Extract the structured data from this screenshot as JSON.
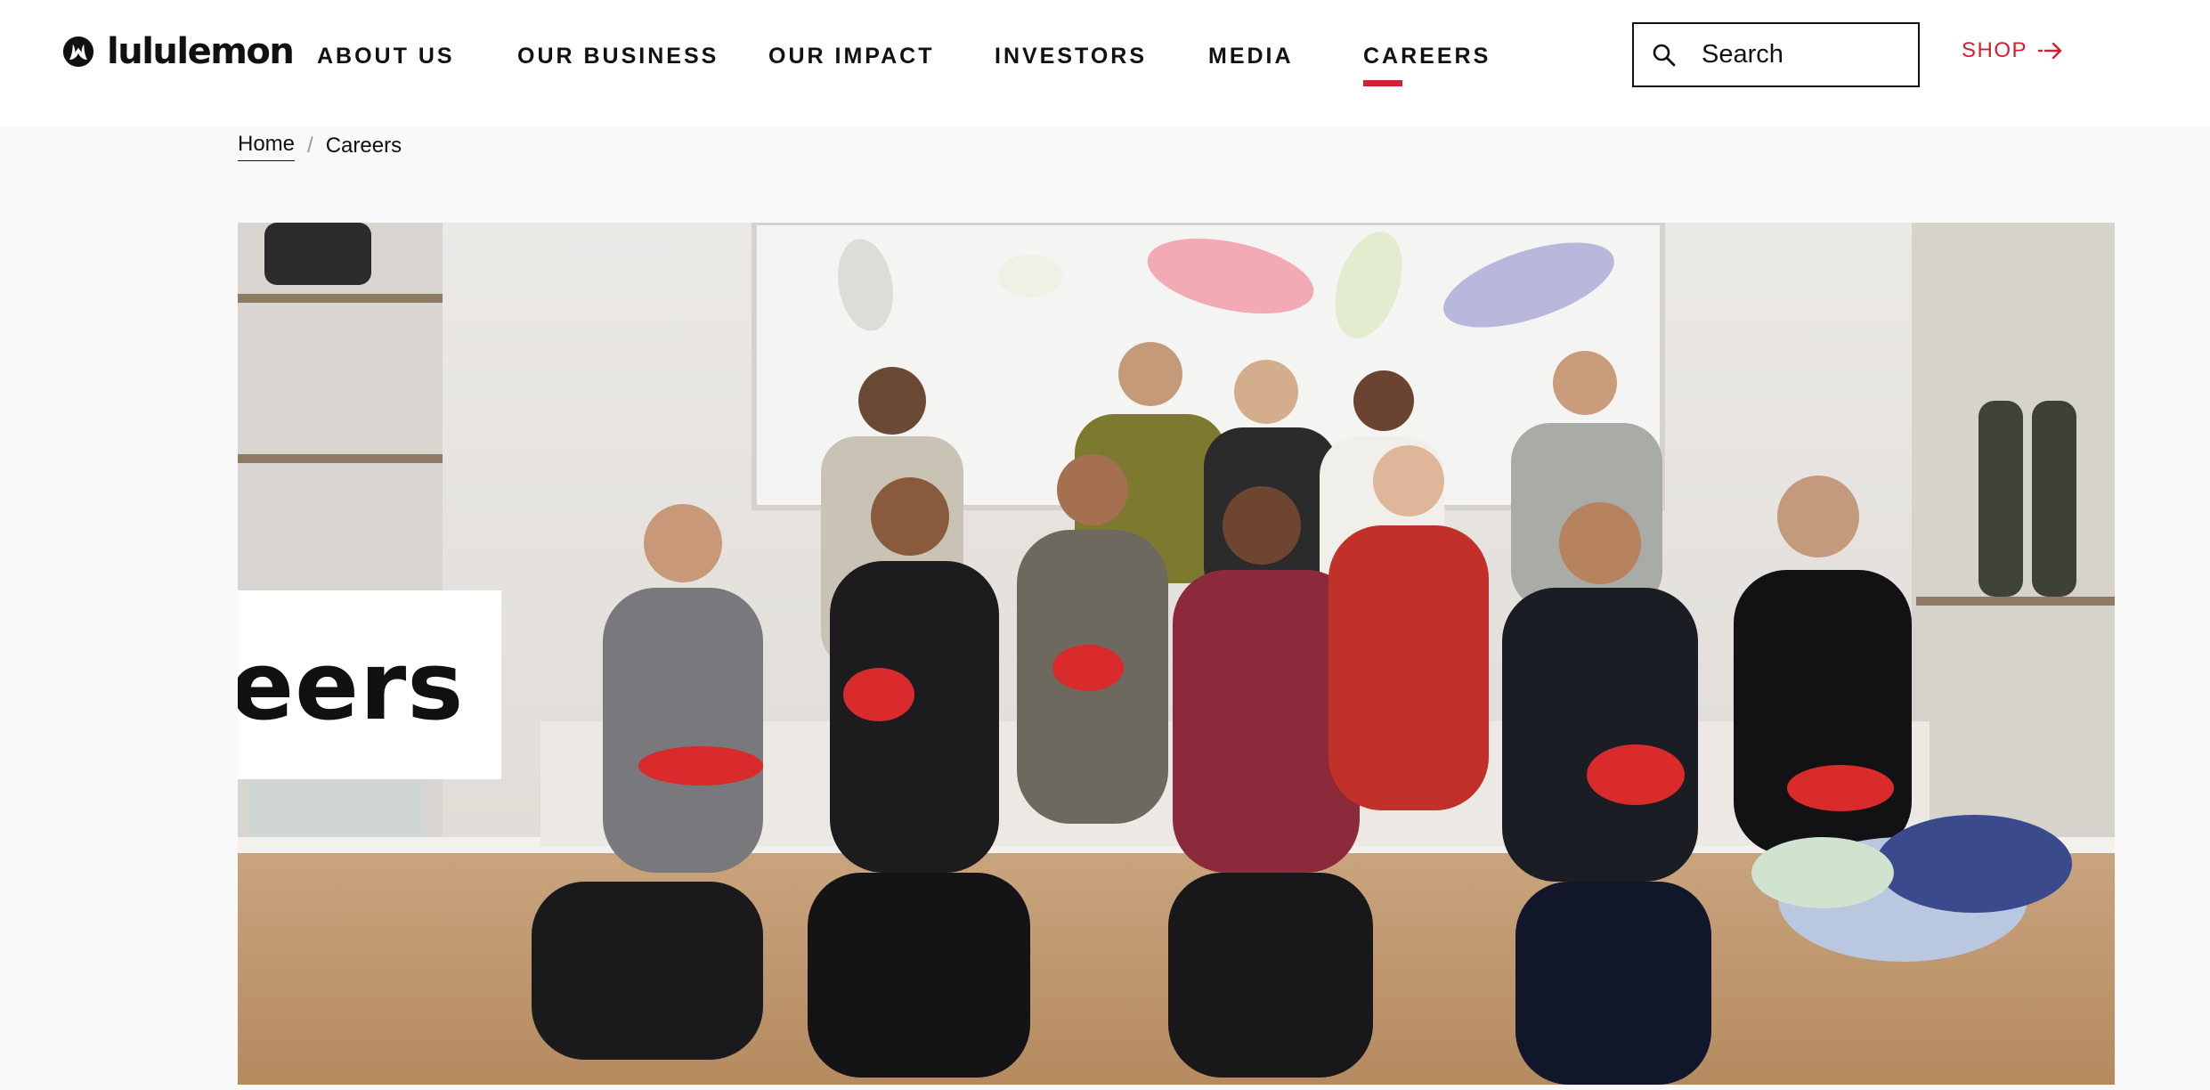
{
  "brand": {
    "name": "lululemon",
    "accent_color": "#d22030"
  },
  "nav": {
    "items": [
      {
        "label": "ABOUT US",
        "active": false
      },
      {
        "label": "OUR BUSINESS",
        "active": false
      },
      {
        "label": "OUR IMPACT",
        "active": false
      },
      {
        "label": "INVESTORS",
        "active": false
      },
      {
        "label": "MEDIA",
        "active": false
      },
      {
        "label": "CAREERS",
        "active": true
      }
    ]
  },
  "search": {
    "placeholder": "Search",
    "icon": "search-icon"
  },
  "shop": {
    "label": "SHOP",
    "icon": "arrow-right-icon"
  },
  "breadcrumb": {
    "items": [
      {
        "label": "Home",
        "link": true
      },
      {
        "label": "Careers",
        "link": false
      }
    ],
    "separator": "/"
  },
  "hero": {
    "title": "Careers",
    "image_subject": "group-photo"
  }
}
